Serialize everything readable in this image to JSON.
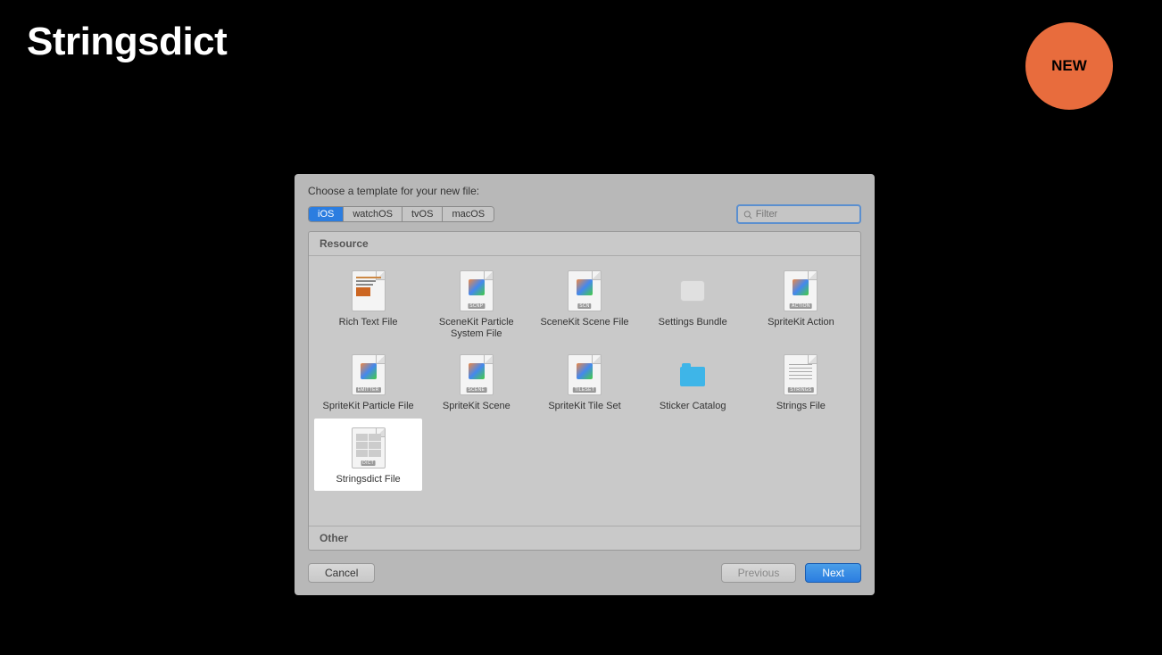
{
  "slide": {
    "title": "Stringsdict",
    "badge": "NEW"
  },
  "dialog": {
    "header": "Choose a template for your new file:",
    "platforms": [
      "iOS",
      "watchOS",
      "tvOS",
      "macOS"
    ],
    "search_placeholder": "Filter",
    "section_resource": "Resource",
    "section_other": "Other",
    "items": [
      {
        "label": "Rich Text File",
        "badge": ""
      },
      {
        "label": "SceneKit Particle System File",
        "badge": "SCNP"
      },
      {
        "label": "SceneKit Scene File",
        "badge": "SCN"
      },
      {
        "label": "Settings Bundle",
        "badge": ""
      },
      {
        "label": "SpriteKit Action",
        "badge": "ACTION"
      },
      {
        "label": "SpriteKit Particle File",
        "badge": "EMITTER"
      },
      {
        "label": "SpriteKit Scene",
        "badge": "SCENE"
      },
      {
        "label": "SpriteKit Tile Set",
        "badge": "TILESET"
      },
      {
        "label": "Sticker Catalog",
        "badge": ""
      },
      {
        "label": "Strings File",
        "badge": "STRINGS"
      },
      {
        "label": "Stringsdict File",
        "badge": "DICT"
      }
    ],
    "buttons": {
      "cancel": "Cancel",
      "previous": "Previous",
      "next": "Next"
    }
  }
}
